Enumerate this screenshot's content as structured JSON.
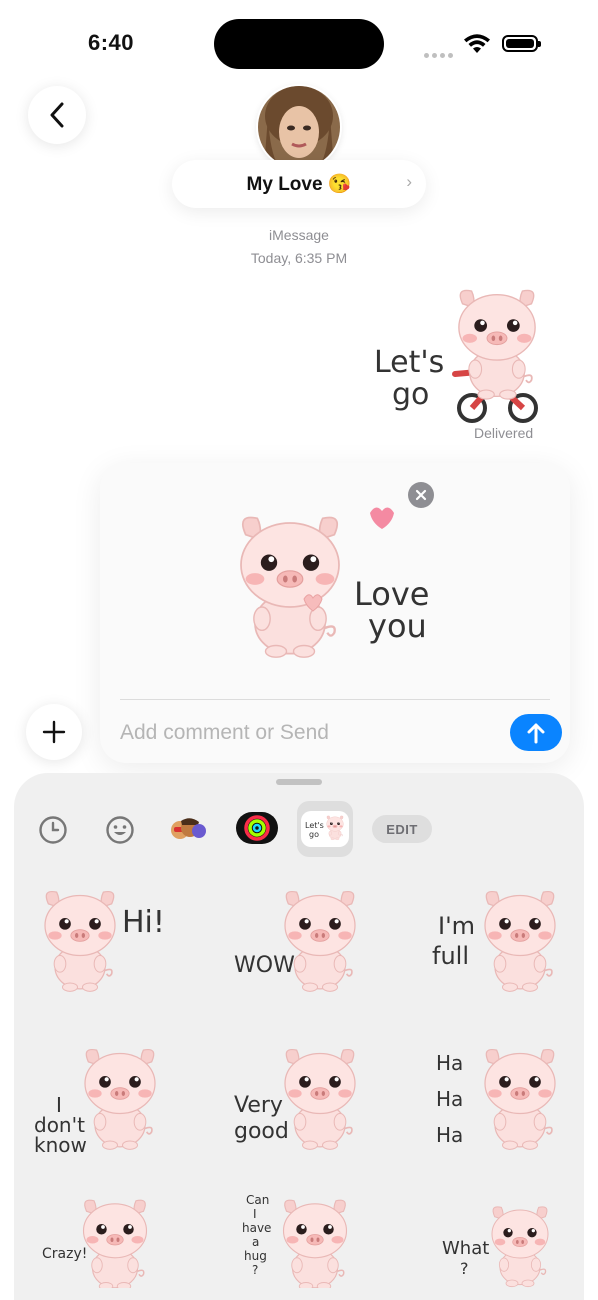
{
  "status_bar": {
    "time": "6:40"
  },
  "header": {
    "contact_name": "My Love 😘",
    "service": "iMessage",
    "timestamp": "Today, 6:35 PM"
  },
  "sent_message": {
    "sticker_text": [
      "Let's",
      "go"
    ],
    "status": "Delivered"
  },
  "compose": {
    "sticker_text": [
      "Love",
      "you"
    ],
    "placeholder": "Add comment or Send"
  },
  "drawer": {
    "tabs": [
      "recents-icon",
      "emoji-icon",
      "memoji-icon",
      "activity-icon",
      "pig-sticker-pack-icon"
    ],
    "pack_tab_text": [
      "Let's",
      "go"
    ],
    "edit_label": "EDIT",
    "stickers": [
      {
        "lines": [
          "Hi!"
        ]
      },
      {
        "lines": [
          "WOW"
        ]
      },
      {
        "lines": [
          "I'm",
          "full"
        ]
      },
      {
        "lines": [
          "I",
          "don't",
          "know"
        ]
      },
      {
        "lines": [
          "Very",
          "good"
        ]
      },
      {
        "lines": [
          "Ha",
          "Ha",
          "Ha"
        ]
      },
      {
        "lines": [
          "Crazy!"
        ]
      },
      {
        "lines": [
          "Can",
          "I",
          "have",
          "a",
          "hug",
          "?"
        ]
      },
      {
        "lines": [
          "What",
          "?"
        ]
      }
    ]
  },
  "colors": {
    "accent": "#0a84ff",
    "pig_pink": "#f9d6d6",
    "blush": "#f4a6a6"
  }
}
